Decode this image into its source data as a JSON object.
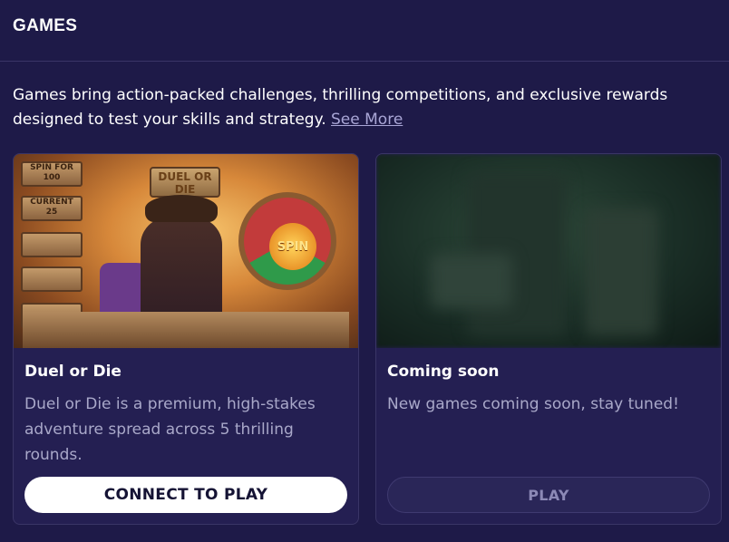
{
  "header": {
    "title": "GAMES"
  },
  "intro": {
    "text": "Games bring action-packed challenges, thrilling competitions, and exclusive rewards designed to test your skills and strategy. ",
    "link": "See More"
  },
  "cards": [
    {
      "image": {
        "boards": [
          "SPIN FOR",
          "100",
          "CURRENT",
          "25"
        ],
        "sign": "DUEL OR DIE",
        "wheel": "SPIN"
      },
      "title": "Duel or Die",
      "description": "Duel or Die is a premium, high-stakes adventure spread across 5 thrilling rounds.",
      "button": "CONNECT TO PLAY"
    },
    {
      "title": "Coming soon",
      "description": "New games coming soon, stay tuned!",
      "button": "PLAY"
    }
  ]
}
